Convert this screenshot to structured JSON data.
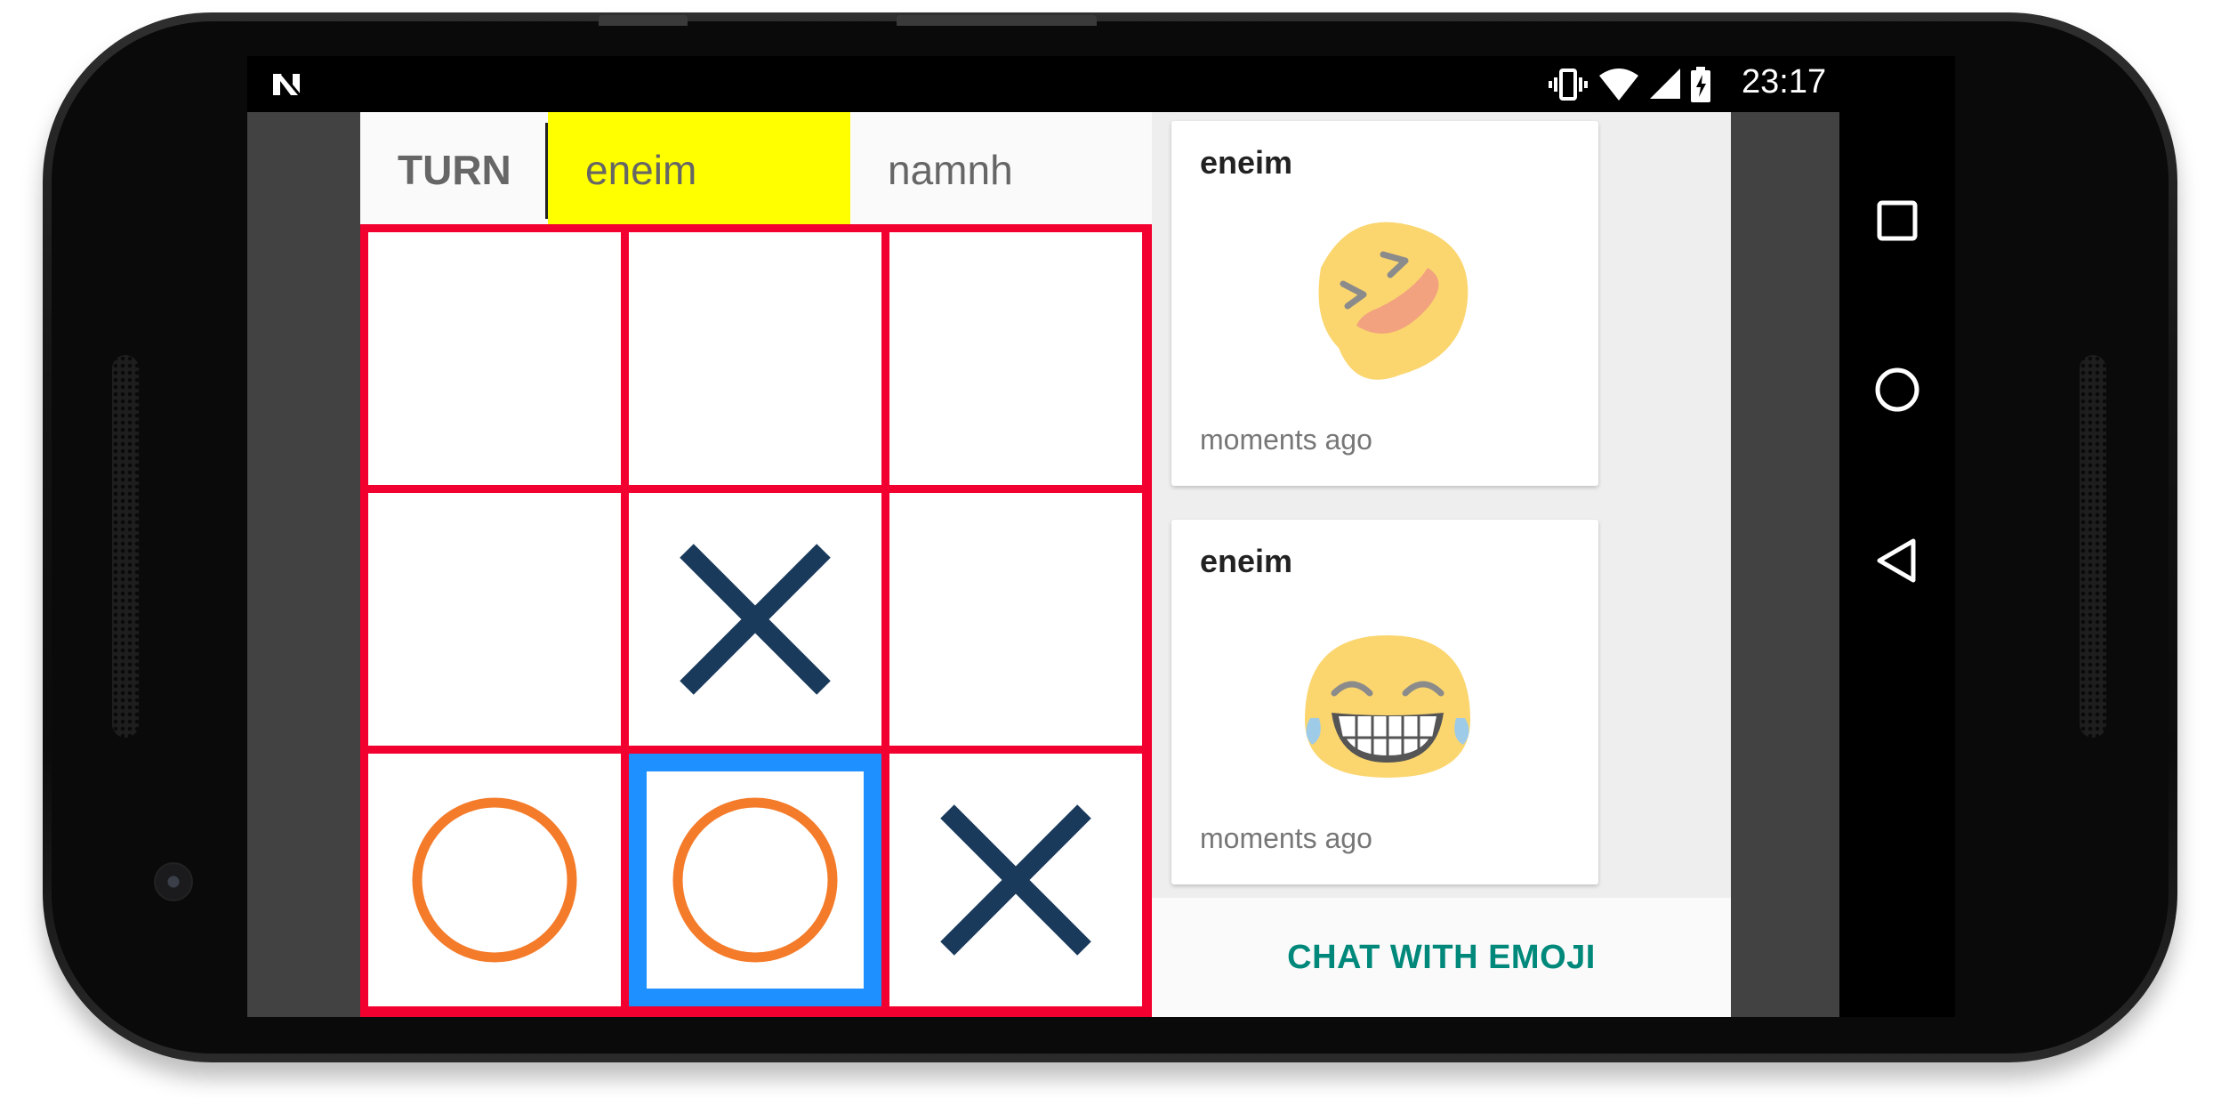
{
  "status_bar": {
    "notification_icon": "n-logo-icon",
    "icons": [
      "vibrate-icon",
      "wifi-icon",
      "signal-icon",
      "battery-charging-icon"
    ],
    "time": "23:17"
  },
  "game": {
    "turn_label": "TURN",
    "active_player": "eneim",
    "other_player": "namnh",
    "colors": {
      "active_highlight": "#ffff00",
      "grid_lines": "#f2002f",
      "x_mark": "#1a3a5c",
      "o_mark": "#f47b2a",
      "selection": "#1e90ff"
    },
    "board": [
      [
        "",
        "",
        ""
      ],
      [
        "",
        "X",
        ""
      ],
      [
        "O",
        "O",
        "X"
      ]
    ],
    "selected_cell": [
      2,
      1
    ]
  },
  "chat": {
    "messages": [
      {
        "sender": "eneim",
        "emoji": "laughing-squint-icon",
        "time": "moments ago"
      },
      {
        "sender": "eneim",
        "emoji": "grinning-tears-icon",
        "time": "moments ago"
      }
    ],
    "button_label": "CHAT WITH EMOJI"
  },
  "nav_bar": {
    "buttons": [
      "recents-square-icon",
      "home-circle-icon",
      "back-triangle-icon"
    ]
  }
}
